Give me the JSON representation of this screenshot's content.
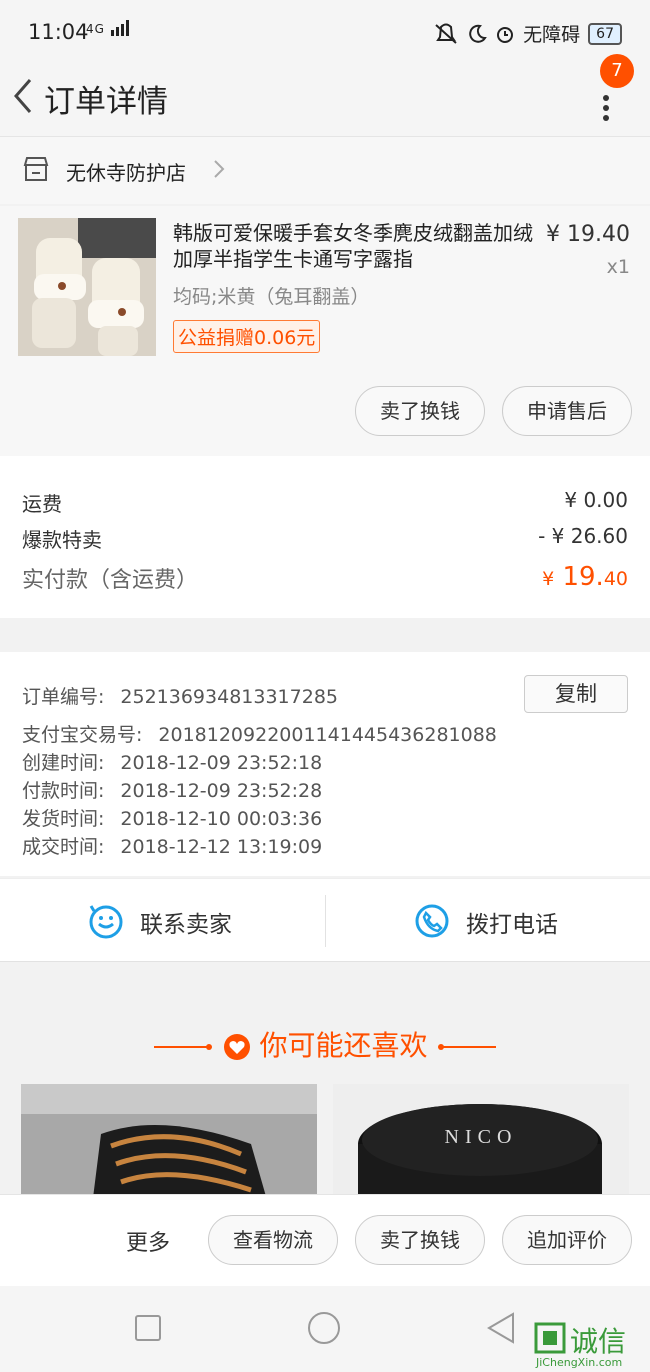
{
  "status_bar": {
    "time": "11:04",
    "network": "4G",
    "accessibility": "无障碍",
    "battery": "67"
  },
  "nav": {
    "title": "订单详情",
    "badge_count": "7"
  },
  "shop": {
    "name": "无休寺防护店"
  },
  "item": {
    "title": "韩版可爱保暖手套女冬季麂皮绒翻盖加绒加厚半指学生卡通写字露指",
    "price": "¥ 19.40",
    "quantity": "x1",
    "spec": "均码;米黄（兔耳翻盖）",
    "donation": "公益捐赠0.06元",
    "actions": [
      "卖了换钱",
      "申请售后"
    ]
  },
  "fees": {
    "shipping_label": "运费",
    "shipping_value": "¥ 0.00",
    "discount_label": "爆款特卖",
    "discount_value": "- ¥ 26.60",
    "total_label": "实付款（含运费）",
    "total_currency": "¥",
    "total_int": "19.",
    "total_dec": "40"
  },
  "order_info": {
    "copy_label": "复制",
    "rows": [
      {
        "label": "订单编号:",
        "value": "252136934813317285"
      },
      {
        "label": "支付宝交易号:",
        "value": "2018120922001141445436281088"
      },
      {
        "label": "创建时间:",
        "value": "2018-12-09 23:52:18"
      },
      {
        "label": "付款时间:",
        "value": "2018-12-09 23:52:28"
      },
      {
        "label": "发货时间:",
        "value": "2018-12-10 00:03:36"
      },
      {
        "label": "成交时间:",
        "value": "2018-12-12 13:19:09"
      }
    ]
  },
  "contact": {
    "seller_label": "联系卖家",
    "phone_label": "拨打电话"
  },
  "recommend": {
    "title": "你可能还喜欢",
    "card2_brand": "NICO"
  },
  "bottom_bar": {
    "more_label": "更多",
    "buttons": [
      "查看物流",
      "卖了换钱",
      "追加评价"
    ]
  },
  "watermark": {
    "brand": "诚信",
    "url": "JiChengXin.com"
  },
  "colors": {
    "accent": "#ff5000",
    "blue_icon": "#1e9fe6"
  }
}
